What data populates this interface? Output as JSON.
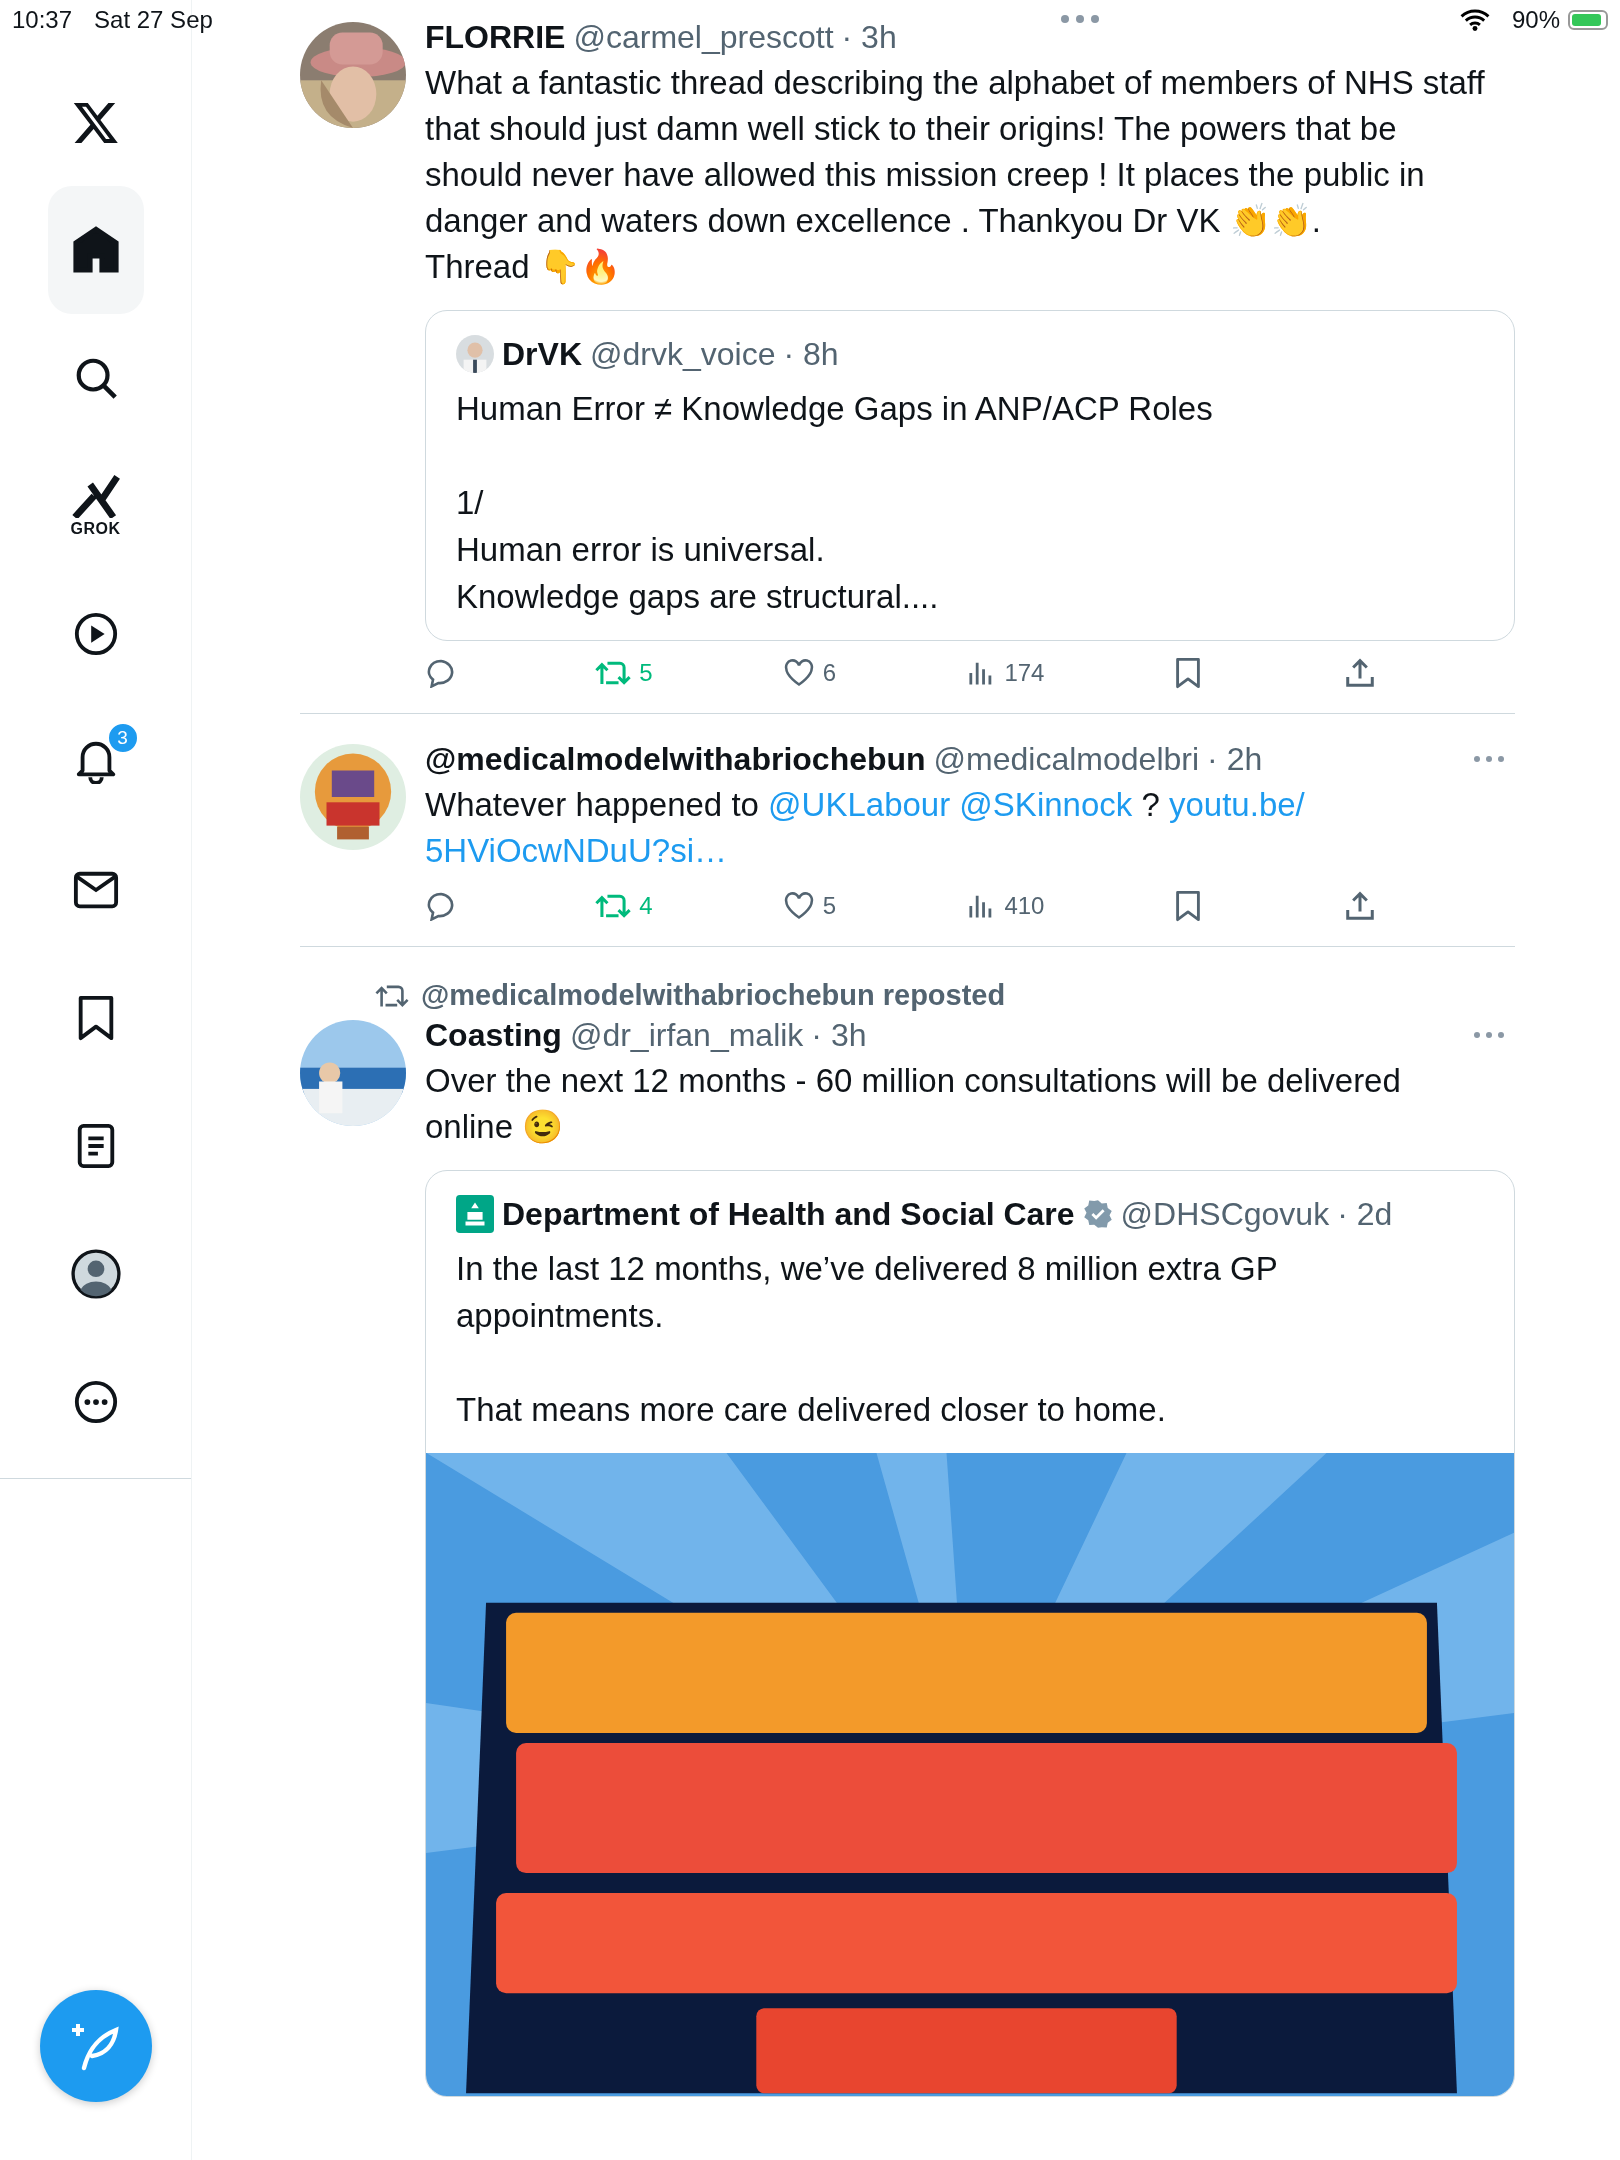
{
  "status_bar": {
    "time": "10:37",
    "date": "Sat 27 Sep",
    "battery": "90%"
  },
  "sidebar": {
    "items": [
      {
        "kind": "logo",
        "selected": false
      },
      {
        "kind": "home",
        "selected": true
      },
      {
        "kind": "search",
        "selected": false
      },
      {
        "kind": "grok",
        "label": "GROK",
        "selected": false
      },
      {
        "kind": "video",
        "selected": false
      },
      {
        "kind": "notifications",
        "badge": "3",
        "selected": false
      },
      {
        "kind": "messages",
        "selected": false
      },
      {
        "kind": "bookmarks",
        "selected": false
      },
      {
        "kind": "lists",
        "selected": false
      },
      {
        "kind": "profile",
        "selected": false
      },
      {
        "kind": "more",
        "selected": false
      }
    ]
  },
  "timeline": [
    {
      "name": "FLORRIE",
      "handle": "@carmel_prescott",
      "time": "· 3h",
      "more_button": false,
      "text": [
        {
          "kind": "text",
          "text": "What a fantastic thread describing the alphabet of members of NHS staff that should just damn well stick to their origins! The powers that be should never have allowed this mission creep ! It places the public in danger and waters down excellence . Thankyou Dr VK 👏👏.\nThread 👇🔥"
        }
      ],
      "quote": {
        "name": "DrVK",
        "handle": "@drvk_voice",
        "time": "· 8h",
        "verified": false,
        "text": "Human Error ≠ Knowledge Gaps in ANP/ACP Roles\n\n1/\nHuman error is universal.\nKnowledge gaps are structural...."
      },
      "actions": {
        "reposts": "5",
        "reposted": true,
        "likes": "6",
        "liked": false,
        "views": "174",
        "bookmarked": false
      }
    },
    {
      "name": "@medicalmodelwithabriochebun",
      "handle": "@medicalmodelbri",
      "time": "· 2h",
      "more_button": true,
      "text": [
        {
          "kind": "text",
          "text": "Whatever happened to"
        },
        {
          "kind": "link",
          "text": "@UKLabour"
        },
        {
          "kind": "link",
          "text": "@SKinnock"
        },
        {
          "kind": "text",
          "text": "?"
        },
        {
          "kind": "link",
          "text": "youtu.be/"
        },
        {
          "kind": "link",
          "text": "5HViOcwNDuU?si…"
        }
      ],
      "actions": {
        "reposts": "4",
        "reposted": true,
        "likes": "5",
        "liked": false,
        "views": "410",
        "bookmarked": false
      }
    },
    {
      "reposted_by": "@medicalmodelwithabriochebun reposted",
      "name": "Coasting",
      "handle": "@dr_irfan_malik",
      "time": "· 3h",
      "more_button": true,
      "text": [
        {
          "kind": "text",
          "text": "Over the next 12 months - 60 million consultations will be delivered online 😉"
        }
      ],
      "quote": {
        "name": "Department of Health and Social Care",
        "handle": "@DHSCgovuk",
        "time": "· 2d",
        "verified": true,
        "text": "In the last 12 months, we’ve delivered 8 million extra GP appointments.\n\nThat means more care delivered closer to home."
      }
    }
  ],
  "compose_button": true
}
